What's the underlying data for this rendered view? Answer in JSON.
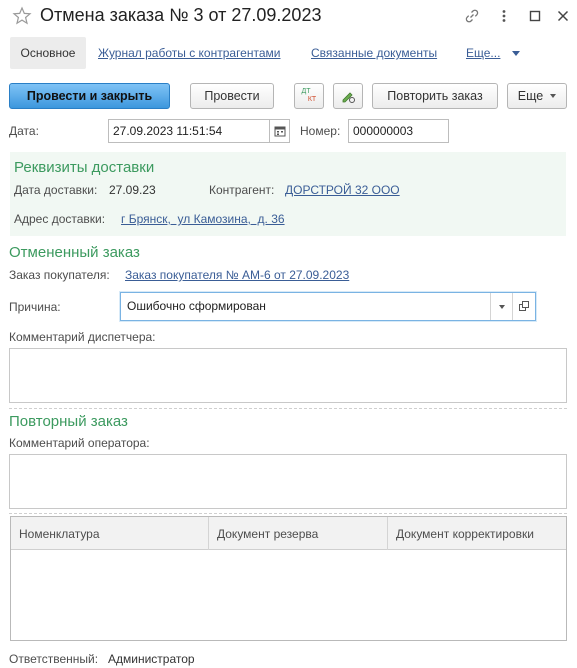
{
  "window": {
    "title": "Отмена заказа № 3 от 27.09.2023"
  },
  "tabs": {
    "main": "Основное",
    "journal": "Журнал работы с контрагентами",
    "related": "Связанные документы",
    "more": "Еще..."
  },
  "toolbar": {
    "post_close": "Провести и закрыть",
    "post": "Провести",
    "dtkt_top": "ДТ",
    "dtkt_bottom": "КТ",
    "repeat_order": "Повторить заказ",
    "more": "Еще"
  },
  "header": {
    "date_label": "Дата:",
    "date_value": "27.09.2023 11:51:54",
    "number_label": "Номер:",
    "number_value": "000000003"
  },
  "delivery": {
    "title": "Реквизиты доставки",
    "date_label": "Дата доставки:",
    "date_value": "27.09.23",
    "contractor_label": "Контрагент:",
    "contractor_value": "ДОРСТРОЙ 32 ООО",
    "address_label": "Адрес доставки:",
    "address_value": "г Брянск,  ул Камозина,  д. 36"
  },
  "cancelled": {
    "title": "Отмененный заказ",
    "order_label": "Заказ покупателя:",
    "order_value": "Заказ покупателя № АМ-6 от 27.09.2023",
    "reason_label": "Причина:",
    "reason_value": "Ошибочно сформирован",
    "dispatcher_comment_label": "Комментарий диспетчера:"
  },
  "repeat": {
    "title": "Повторный заказ",
    "operator_comment_label": "Комментарий оператора:"
  },
  "table": {
    "columns": [
      "Номенклатура",
      "Документ резерва",
      "Документ корректировки"
    ]
  },
  "footer": {
    "responsible_label": "Ответственный:",
    "responsible_value": "Администратор"
  },
  "colors": {
    "accent_green": "#3c9a5f",
    "link_blue": "#3a5d96",
    "primary_button": "#4aa3e6"
  }
}
